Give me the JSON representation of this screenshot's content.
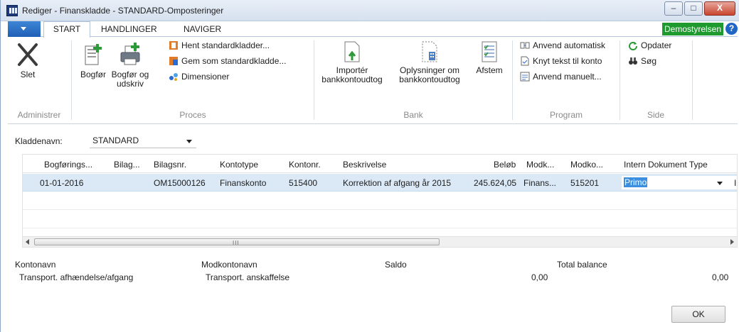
{
  "window": {
    "title": "Rediger - Finanskladde - STANDARD-Omposteringer",
    "minimize": "–",
    "maximize": "□",
    "close": "X"
  },
  "tabs": [
    "START",
    "HANDLINGER",
    "NAVIGER"
  ],
  "company": "Demostyrelsen",
  "help": "?",
  "ribbon": {
    "groups": {
      "administrer": "Administrer",
      "proces": "Proces",
      "bank": "Bank",
      "program": "Program",
      "side": "Side"
    },
    "slet": "Slet",
    "bogfor": "Bogfør",
    "bogfor_udskriv_1": "Bogfør og",
    "bogfor_udskriv_2": "udskriv",
    "hent_standard": "Hent standardkladder...",
    "gem_standard": "Gem som standardkladde...",
    "dimensioner": "Dimensioner",
    "importer_1": "Importér",
    "importer_2": "bankkontoudtog",
    "oplysninger_1": "Oplysninger om",
    "oplysninger_2": "bankkontoudtog",
    "afstem": "Afstem",
    "anvend_automatisk": "Anvend automatisk",
    "knyt_tekst": "Knyt tekst til konto",
    "anvend_manuelt": "Anvend manuelt...",
    "opdater": "Opdater",
    "sog": "Søg"
  },
  "form": {
    "kladdenavn_label": "Kladdenavn:",
    "kladdenavn_value": "STANDARD"
  },
  "grid": {
    "columns": [
      "Bogførings...",
      "Bilag...",
      "Bilagsnr.",
      "Kontotype",
      "Kontonr.",
      "Beskrivelse",
      "Beløb",
      "Modk...",
      "Modko...",
      "Intern Dokument Type"
    ],
    "rows": [
      {
        "date": "01-01-2016",
        "bilag": "",
        "bilagsnr": "OM15000126",
        "kontotype": "Finanskonto",
        "kontonr": "515400",
        "beskrivelse": "Korrektion af afgang år 2015",
        "belob": "245.624,05",
        "modk": "Finans...",
        "modko": "515201",
        "intern": "Primo",
        "overflow": "I"
      }
    ]
  },
  "summary": {
    "kontonavn_label": "Kontonavn",
    "kontonavn_value": "Transport. afhændelse/afgang",
    "modkontonavn_label": "Modkontonavn",
    "modkontonavn_value": "Transport. anskaffelse",
    "saldo_label": "Saldo",
    "saldo_value": "0,00",
    "total_label": "Total balance",
    "total_value": "0,00"
  },
  "ok": "OK",
  "scroll_grip": "III",
  "colors": {
    "accent": "#1f5fb6",
    "company_badge": "#1e9a2e",
    "selected_row": "#dbe9f7",
    "selection": "#3b8ee0"
  }
}
